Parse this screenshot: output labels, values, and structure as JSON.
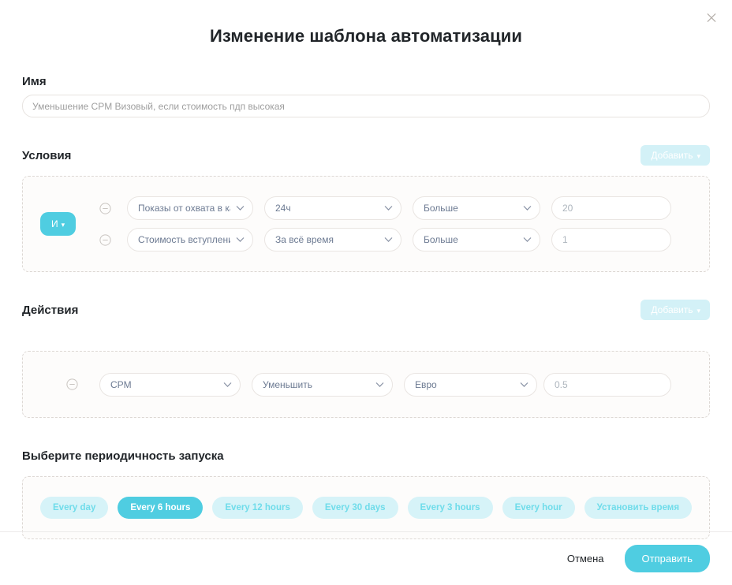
{
  "window": {
    "title": "Изменение шаблона автоматизации",
    "close_icon": "close-icon"
  },
  "name_field": {
    "label": "Имя",
    "value": "",
    "placeholder": "Уменьшение CPM Визовый, если стоимость пдп высокая"
  },
  "conditions": {
    "title": "Условия",
    "add_label": "Добавить",
    "add_caret": "▾",
    "logic_operator": "И",
    "logic_caret": "▾",
    "remove_icon": "minus-circle-icon",
    "chevron_icon": "chevron-down-icon",
    "rows": [
      {
        "metric": "Показы от охвата в канале",
        "period": "24ч",
        "comparison": "Больше",
        "value": "",
        "value_placeholder": "20"
      },
      {
        "metric": "Стоимость вступления (CP",
        "period": "За всё время",
        "comparison": "Больше",
        "value": "",
        "value_placeholder": "1"
      }
    ]
  },
  "actions": {
    "title": "Действия",
    "add_label": "Добавить",
    "add_caret": "▾",
    "remove_icon": "minus-circle-icon",
    "rows": [
      {
        "parameter": "CPM",
        "operation": "Уменьшить",
        "unit": "Евро",
        "value": "",
        "value_placeholder": "0.5"
      }
    ]
  },
  "periodicity": {
    "title": "Выберите периодичность запуска",
    "options": [
      {
        "label": "Every day",
        "selected": false
      },
      {
        "label": "Every 6 hours",
        "selected": true
      },
      {
        "label": "Every 12 hours",
        "selected": false
      },
      {
        "label": "Every 30 days",
        "selected": false
      },
      {
        "label": "Every 3 hours",
        "selected": false
      },
      {
        "label": "Every hour",
        "selected": false
      },
      {
        "label": "Установить время",
        "selected": false
      }
    ]
  },
  "footer": {
    "cancel_label": "Отмена",
    "submit_label": "Отправить"
  },
  "colors": {
    "accent": "#4fcde1",
    "accent_soft": "#d6f3f8",
    "accent_add": "#d3f1f7",
    "panel_bg": "#fdfcfb",
    "panel_border": "#ddd8d4",
    "select_text": "#6c7a92"
  }
}
